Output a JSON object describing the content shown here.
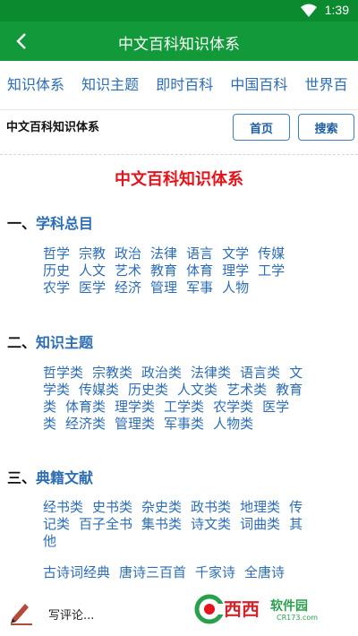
{
  "status": {
    "time": "1:39"
  },
  "appbar": {
    "title": "中文百科知识体系"
  },
  "tabs": [
    "知识体系",
    "知识主题",
    "即时百科",
    "中国百科",
    "世界百"
  ],
  "subbar": {
    "crumb": "中文百科知识体系",
    "home": "首页",
    "search": "搜索"
  },
  "content": {
    "title": "中文百科知识体系",
    "sections": [
      {
        "index": "一、",
        "title": "学科总目",
        "lines": [
          [
            "哲学",
            "宗教",
            "政治",
            "法律",
            "语言",
            "文学",
            "传媒"
          ],
          [
            "历史",
            "人文",
            "艺术",
            "教育",
            "体育",
            "理学",
            "工学"
          ],
          [
            "农学",
            "医学",
            "经济",
            "管理",
            "军事",
            "人物"
          ]
        ]
      },
      {
        "index": "二、",
        "title": "知识主题",
        "lines": [
          [
            "哲学类",
            "宗教类",
            "政治类",
            "法律类",
            "语言类",
            "文"
          ],
          [
            "学类",
            "传媒类",
            "历史类",
            "人文类",
            "艺术类",
            "教育"
          ],
          [
            "类",
            "体育类",
            "理学类",
            "工学类",
            "农学类",
            "医学"
          ],
          [
            "类",
            "经济类",
            "管理类",
            "军事类",
            "人物类"
          ]
        ]
      },
      {
        "index": "三、",
        "title": "典籍文献",
        "lines": [
          [
            "经书类",
            "史书类",
            "杂史类",
            "政书类",
            "地理类",
            "传"
          ],
          [
            "记类",
            "百子全书",
            "集书类",
            "诗文类",
            "词曲类",
            "其"
          ],
          [
            "他"
          ]
        ],
        "extra": [
          "古诗词经典",
          "唐诗三百首",
          "千家诗",
          "全唐诗"
        ]
      }
    ]
  },
  "bottom": {
    "comment": "写评论...",
    "logo_text": "西西",
    "logo_brand": "软件园",
    "logo_url": "CR173.com"
  },
  "colors": {
    "green_dark": "#0c8a2f",
    "green": "#129a3a",
    "link_blue": "#2d6db5",
    "title_red": "#e3141b"
  }
}
